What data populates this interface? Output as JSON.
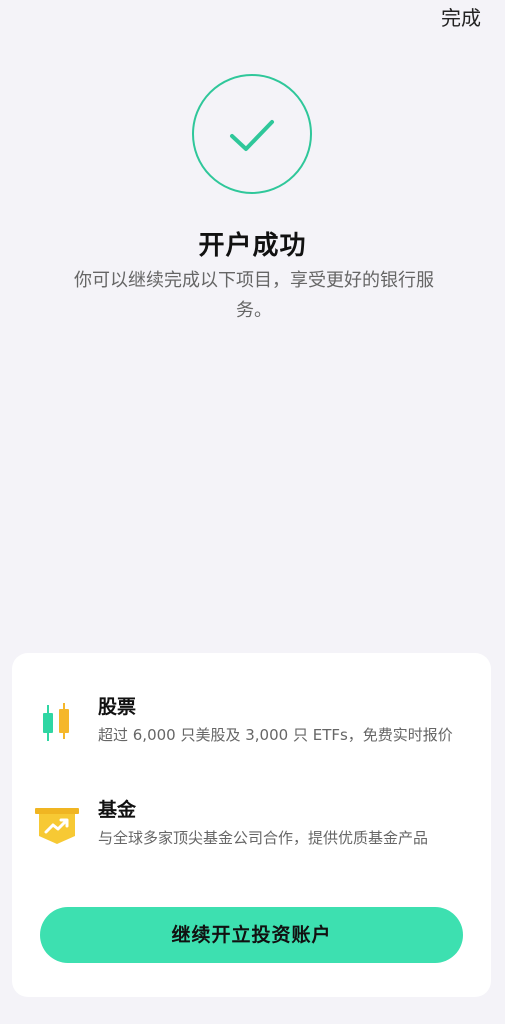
{
  "header": {
    "done_label": "完成"
  },
  "status": {
    "title": "开户成功",
    "subtitle": "你可以继续完成以下项目，享受更好的银行服务。",
    "icon": "check-icon",
    "accent_color": "#2fc79a"
  },
  "products": [
    {
      "title": "股票",
      "description": "超过 6,000 只美股及 3,000 只 ETFs，免费实时报价",
      "icon": "candlestick-chart-icon",
      "icon_colors": [
        "#2fd6a3",
        "#f5b72b"
      ]
    },
    {
      "title": "基金",
      "description": "与全球多家顶尖基金公司合作，提供优质基金产品",
      "icon": "fund-chart-icon",
      "icon_colors": [
        "#f5c52b"
      ]
    }
  ],
  "cta": {
    "label": "继续开立投资账户",
    "color": "#3de0b0"
  }
}
